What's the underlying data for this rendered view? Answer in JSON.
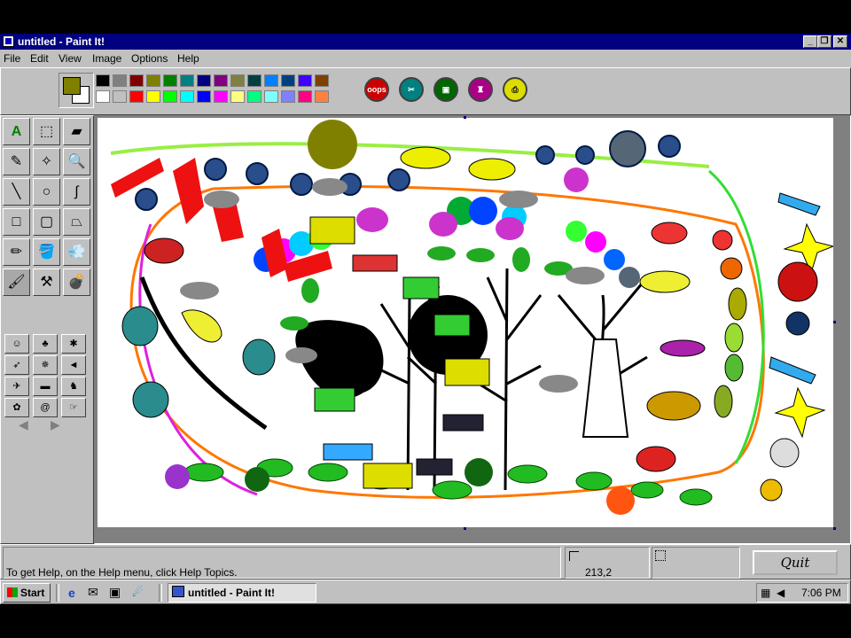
{
  "window": {
    "title": "untitled - Paint It!"
  },
  "menu": [
    {
      "label": "File"
    },
    {
      "label": "Edit"
    },
    {
      "label": "View"
    },
    {
      "label": "Image"
    },
    {
      "label": "Options"
    },
    {
      "label": "Help"
    }
  ],
  "palette": {
    "primary": "#808000",
    "secondary": "#ffffff",
    "row1": [
      "#000000",
      "#808080",
      "#800000",
      "#808000",
      "#008000",
      "#008080",
      "#000080",
      "#800080",
      "#808040",
      "#004040",
      "#0080ff",
      "#004080",
      "#4000ff",
      "#804000"
    ],
    "row2": [
      "#ffffff",
      "#c0c0c0",
      "#ff0000",
      "#ffff00",
      "#00ff00",
      "#00ffff",
      "#0000ff",
      "#ff00ff",
      "#ffff80",
      "#00ff80",
      "#80ffff",
      "#8080ff",
      "#ff0080",
      "#ff8040"
    ]
  },
  "action_buttons": [
    {
      "label": "oops",
      "icon": "oops-icon",
      "color": "#cc0000"
    },
    {
      "label": "",
      "icon": "scissors-icon",
      "color": "#008080"
    },
    {
      "label": "",
      "icon": "camera-icon",
      "color": "#006600"
    },
    {
      "label": "",
      "icon": "bottle-icon",
      "color": "#aa0088"
    },
    {
      "label": "",
      "icon": "printer-icon",
      "color": "#dddd00"
    }
  ],
  "tools": [
    {
      "name": "text",
      "glyph": "A"
    },
    {
      "name": "select-rect",
      "glyph": "⬚"
    },
    {
      "name": "eraser",
      "glyph": "▰"
    },
    {
      "name": "dropper",
      "glyph": "✎"
    },
    {
      "name": "select-free",
      "glyph": "✧"
    },
    {
      "name": "magnifier",
      "glyph": "🔍"
    },
    {
      "name": "line",
      "glyph": "╲"
    },
    {
      "name": "ellipse",
      "glyph": "○"
    },
    {
      "name": "curve",
      "glyph": "∫"
    },
    {
      "name": "rectangle",
      "glyph": "□"
    },
    {
      "name": "rounded-rect",
      "glyph": "▢"
    },
    {
      "name": "polygon",
      "glyph": "⏢"
    },
    {
      "name": "pencil",
      "glyph": "✏"
    },
    {
      "name": "fill",
      "glyph": "🪣"
    },
    {
      "name": "spray",
      "glyph": "💨"
    },
    {
      "name": "brush",
      "glyph": "🖌"
    },
    {
      "name": "stamp",
      "glyph": "⚒"
    },
    {
      "name": "bomb",
      "glyph": "💣"
    }
  ],
  "stamps": [
    {
      "name": "smiley",
      "glyph": "☺"
    },
    {
      "name": "tree",
      "glyph": "♣"
    },
    {
      "name": "bug",
      "glyph": "✱"
    },
    {
      "name": "rocket",
      "glyph": "➶"
    },
    {
      "name": "spider",
      "glyph": "✵"
    },
    {
      "name": "fish",
      "glyph": "◄"
    },
    {
      "name": "shuttle",
      "glyph": "✈"
    },
    {
      "name": "car",
      "glyph": "▬"
    },
    {
      "name": "dog",
      "glyph": "♞"
    },
    {
      "name": "frog",
      "glyph": "✿"
    },
    {
      "name": "spiral",
      "glyph": "@"
    },
    {
      "name": "hand",
      "glyph": "☞"
    }
  ],
  "status": {
    "help_text": "To get Help, on the Help menu, click Help Topics.",
    "coords": "213,2",
    "quit_label": "Quit"
  },
  "taskbar": {
    "start_label": "Start",
    "task_label": "untitled - Paint It!",
    "time": "7:06 PM"
  }
}
